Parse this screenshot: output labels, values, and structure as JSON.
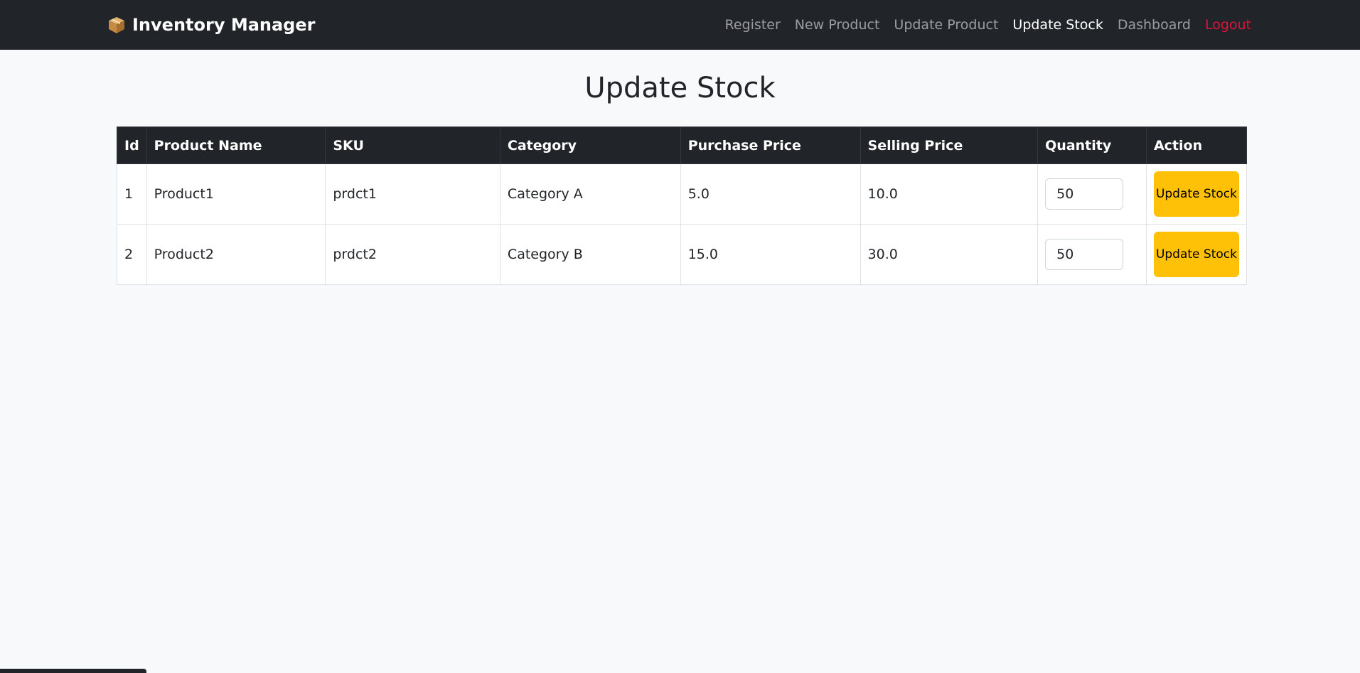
{
  "navbar": {
    "brand_icon": "package-box-icon",
    "brand": "Inventory Manager",
    "links": [
      {
        "label": "Register"
      },
      {
        "label": "New Product"
      },
      {
        "label": "Update Product"
      },
      {
        "label": "Update Stock"
      },
      {
        "label": "Dashboard"
      },
      {
        "label": "Logout"
      }
    ],
    "active": "Update Stock",
    "logout_color": "#dc143c"
  },
  "page_title": "Update Stock",
  "table": {
    "headers": [
      "Id",
      "Product Name",
      "SKU",
      "Category",
      "Purchase Price",
      "Selling Price",
      "Quantity",
      "Action"
    ],
    "rows": [
      {
        "id": "1",
        "name": "Product1",
        "sku": "prdct1",
        "category": "Category A",
        "purchase_price": "5.0",
        "selling_price": "10.0",
        "quantity": "50",
        "action_label": "Update Stock"
      },
      {
        "id": "2",
        "name": "Product2",
        "sku": "prdct2",
        "category": "Category B",
        "purchase_price": "15.0",
        "selling_price": "30.0",
        "quantity": "50",
        "action_label": "Update Stock"
      }
    ]
  },
  "colors": {
    "navbar_bg": "#212529",
    "page_bg": "#f8f9fa",
    "button_warning": "#ffc107"
  }
}
